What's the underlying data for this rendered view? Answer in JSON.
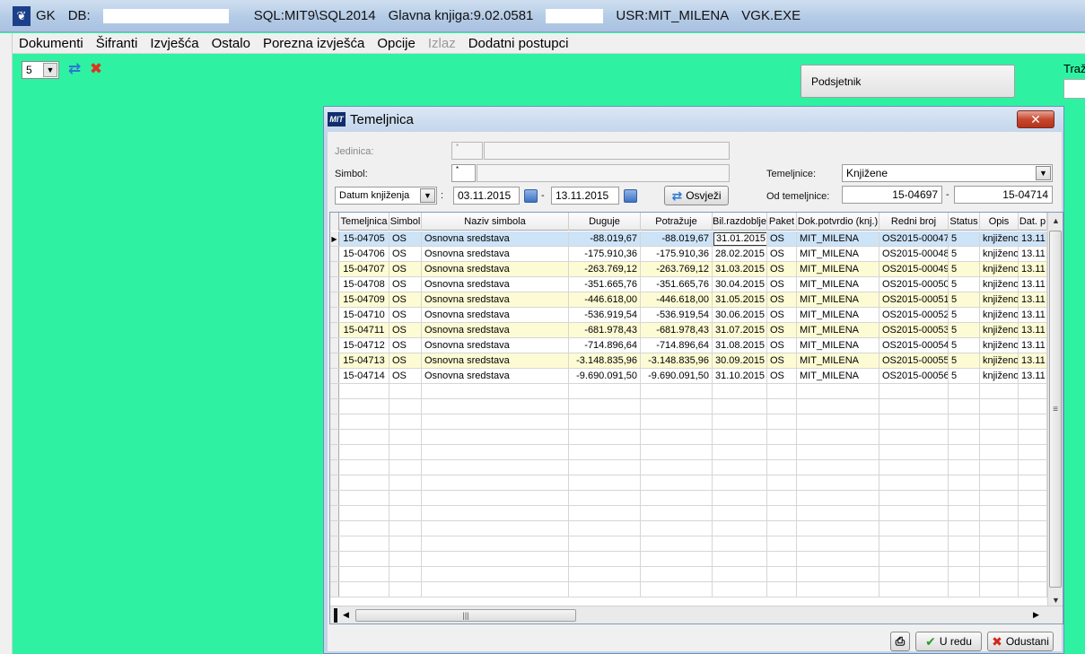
{
  "titlebar": {
    "app": "GK",
    "db_label": "DB:",
    "sql": "SQL:MIT9\\SQL2014",
    "version": "Glavna knjiga:9.02.0581",
    "user": "USR:MIT_MILENA",
    "exe": "VGK.EXE"
  },
  "menu": [
    "Dokumenti",
    "Šifranti",
    "Izvješća",
    "Ostalo",
    "Porezna izvješća",
    "Opcije",
    "Izlaz",
    "Dodatni postupci"
  ],
  "toolbar": {
    "page_value": "5"
  },
  "podsjetnik_label": "Podsjetnik",
  "trazi_label": "Traž",
  "dialog": {
    "title": "Temeljnica",
    "icon_text": "MIT",
    "close_label": "✕",
    "jedinica_label": "Jedinica:",
    "jedinica_code": "*",
    "simbol_label": "Simbol:",
    "simbol_code": "*",
    "date_type": "Datum knjiženja",
    "date_from": "03.11.2015",
    "date_to": "13.11.2015",
    "refresh_label": "Osvježi",
    "temeljnice_label": "Temeljnice:",
    "temeljnice_value": "Knjižene",
    "od_label": "Od temeljnice:",
    "od_from": "15-04697",
    "od_to": "15-04714",
    "ok_label": "U redu",
    "cancel_label": "Odustani"
  },
  "grid": {
    "columns": [
      "Temeljnica",
      "Simbol",
      "Naziv simbola",
      "Duguje",
      "Potražuje",
      "Bil.razdoblje",
      "Paket",
      "Dok.potvrdio (knj.)",
      "Redni broj",
      "Status",
      "Opis",
      "Dat. p"
    ],
    "rows": [
      [
        "15-04705",
        "OS",
        "Osnovna sredstava",
        "-88.019,67",
        "-88.019,67",
        "31.01.2015",
        "OS",
        "MIT_MILENA",
        "OS2015-00047",
        "5",
        "knjiženo",
        "13.11"
      ],
      [
        "15-04706",
        "OS",
        "Osnovna sredstava",
        "-175.910,36",
        "-175.910,36",
        "28.02.2015",
        "OS",
        "MIT_MILENA",
        "OS2015-00048",
        "5",
        "knjiženo",
        "13.11"
      ],
      [
        "15-04707",
        "OS",
        "Osnovna sredstava",
        "-263.769,12",
        "-263.769,12",
        "31.03.2015",
        "OS",
        "MIT_MILENA",
        "OS2015-00049",
        "5",
        "knjiženo",
        "13.11"
      ],
      [
        "15-04708",
        "OS",
        "Osnovna sredstava",
        "-351.665,76",
        "-351.665,76",
        "30.04.2015",
        "OS",
        "MIT_MILENA",
        "OS2015-00050",
        "5",
        "knjiženo",
        "13.11"
      ],
      [
        "15-04709",
        "OS",
        "Osnovna sredstava",
        "-446.618,00",
        "-446.618,00",
        "31.05.2015",
        "OS",
        "MIT_MILENA",
        "OS2015-00051",
        "5",
        "knjiženo",
        "13.11"
      ],
      [
        "15-04710",
        "OS",
        "Osnovna sredstava",
        "-536.919,54",
        "-536.919,54",
        "30.06.2015",
        "OS",
        "MIT_MILENA",
        "OS2015-00052",
        "5",
        "knjiženo",
        "13.11"
      ],
      [
        "15-04711",
        "OS",
        "Osnovna sredstava",
        "-681.978,43",
        "-681.978,43",
        "31.07.2015",
        "OS",
        "MIT_MILENA",
        "OS2015-00053",
        "5",
        "knjiženo",
        "13.11"
      ],
      [
        "15-04712",
        "OS",
        "Osnovna sredstava",
        "-714.896,64",
        "-714.896,64",
        "31.08.2015",
        "OS",
        "MIT_MILENA",
        "OS2015-00054",
        "5",
        "knjiženo",
        "13.11"
      ],
      [
        "15-04713",
        "OS",
        "Osnovna sredstava",
        "-3.148.835,96",
        "-3.148.835,96",
        "30.09.2015",
        "OS",
        "MIT_MILENA",
        "OS2015-00055",
        "5",
        "knjiženo",
        "13.11"
      ],
      [
        "15-04714",
        "OS",
        "Osnovna sredstava",
        "-9.690.091,50",
        "-9.690.091,50",
        "31.10.2015",
        "OS",
        "MIT_MILENA",
        "OS2015-00056",
        "5",
        "knjiženo",
        "13.11"
      ]
    ],
    "empty_rows": 14,
    "selected_row": 0
  },
  "colors": {
    "desktop": "#2ef2a2",
    "row_alt": "#fdfbd3",
    "row_selected": "#cde3f7"
  }
}
